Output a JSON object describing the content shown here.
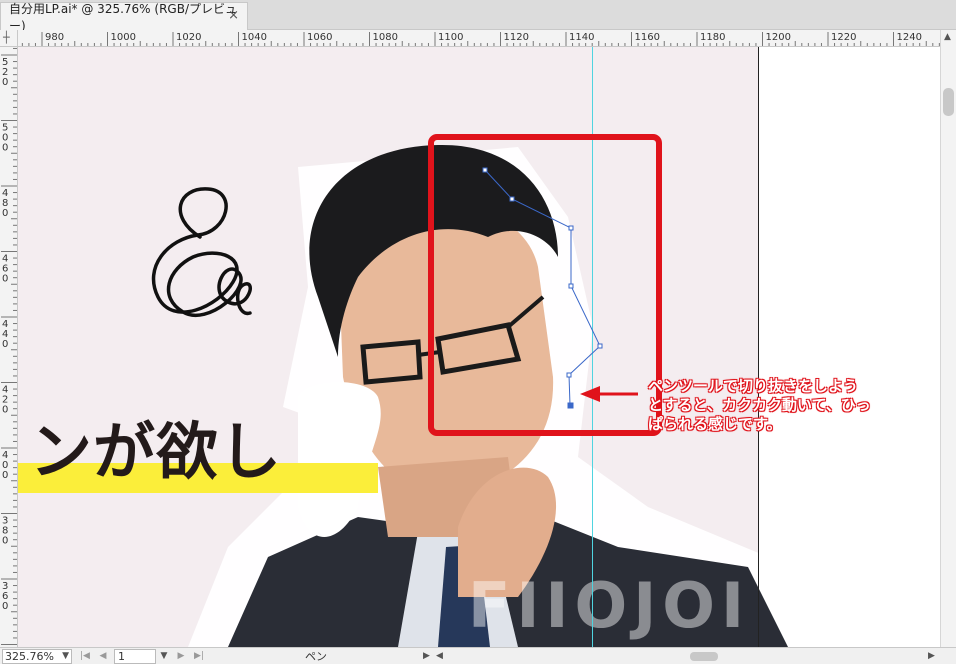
{
  "document_tab": {
    "title": "自分用LP.ai* @ 325.76% (RGB/プレビュー)",
    "close_symbol": "×"
  },
  "ruler": {
    "corner_mark": "┼",
    "h_labels": [
      "980",
      "1000",
      "1020",
      "1040",
      "1060",
      "1080",
      "1100",
      "1120",
      "1140",
      "1160",
      "1180",
      "1200",
      "1220",
      "1240"
    ],
    "v_labels": [
      "520",
      "500",
      "480",
      "460",
      "440",
      "420",
      "400",
      "380",
      "360"
    ]
  },
  "artwork": {
    "headline": "ンが欲し",
    "highlight_color": "#fbee3a",
    "headline_color": "#231a1a",
    "artboard_color": "#f4edf0",
    "guide_color": "#4fd4e0",
    "path_color": "#3b68c9",
    "frame_color": "#e0131b"
  },
  "annotation": {
    "lines": [
      "ペンツールで切り抜きをしよう",
      "とすると、カクカク動いて、ひっ",
      "ぱられる感じです。"
    ],
    "color": "#e0131b"
  },
  "status_bar": {
    "zoom": "325.76%",
    "page": "1",
    "tool": "ペン"
  }
}
